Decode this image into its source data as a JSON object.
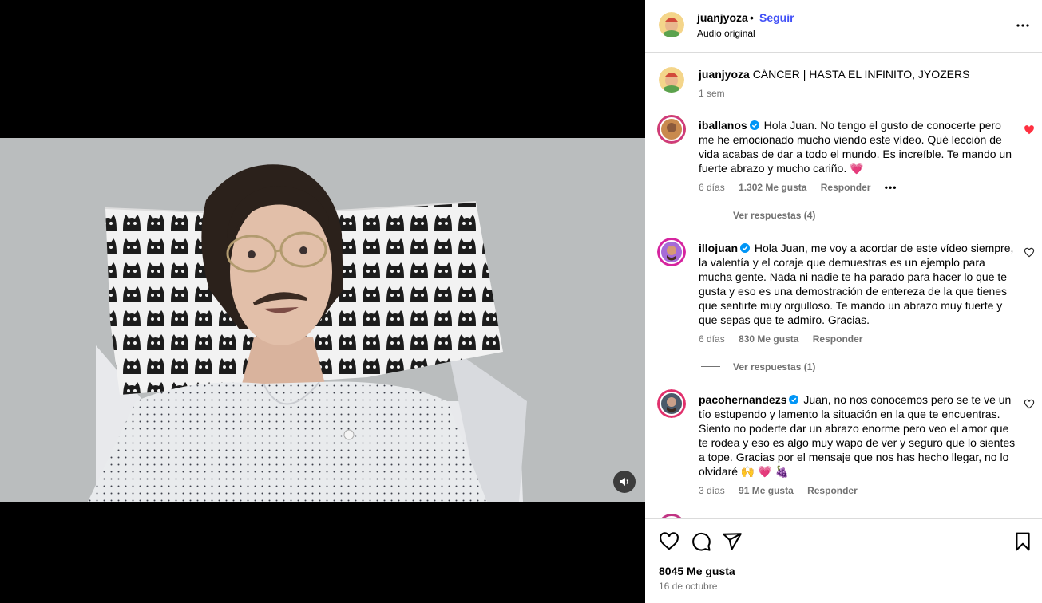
{
  "post": {
    "username": "juanjyoza",
    "separator": "•",
    "follow_label": "Seguir",
    "audio": "Audio original",
    "caption_text": "CÁNCER | HASTA EL INFINITO, JYOZERS",
    "caption_time": "1 sem"
  },
  "comments": [
    {
      "username": "iballanos",
      "text": "Hola Juan. No tengo el gusto de conocerte pero me he emocionado mucho viendo este vídeo. Qué lección de vida acabas de dar a todo el mundo. Es increíble. Te mando un fuerte abrazo y mucho cariño. 💗",
      "time": "6 días",
      "likes": "1.302 Me gusta",
      "reply_label": "Responder",
      "more": "•••",
      "view_replies": "Ver respuestas (4)",
      "liked": true
    },
    {
      "username": "illojuan",
      "text": "Hola Juan, me voy a acordar de este vídeo siempre, la valentía y el coraje que demuestras es un ejemplo para mucha gente. Nada ni nadie te ha parado para hacer lo que te gusta y eso es una demostración de entereza de la que tienes que sentirte muy orgulloso. Te mando un abrazo muy fuerte y que sepas que te admiro. Gracias.",
      "time": "6 días",
      "likes": "830 Me gusta",
      "reply_label": "Responder",
      "view_replies": "Ver respuestas (1)",
      "liked": false
    },
    {
      "username": "pacohernandezs",
      "text": "Juan, no nos conocemos pero se te ve un tío estupendo y lamento la situación en la que te encuentras. Siento no poderte dar un abrazo enorme pero veo el amor que te rodea y eso es algo muy wapo de ver y seguro que lo sientes a tope. Gracias por el mensaje que nos has hecho llegar, no lo olvidaré 🙌 💗 🍇",
      "time": "3 días",
      "likes": "91 Me gusta",
      "reply_label": "Responder",
      "liked": false
    }
  ],
  "footer": {
    "likes": "8045 Me gusta",
    "date": "16 de octubre"
  },
  "colors": {
    "link_blue": "#4150f7",
    "verified_blue": "#0095f6",
    "heart_red": "#ff3040",
    "muted_text": "#737373"
  }
}
